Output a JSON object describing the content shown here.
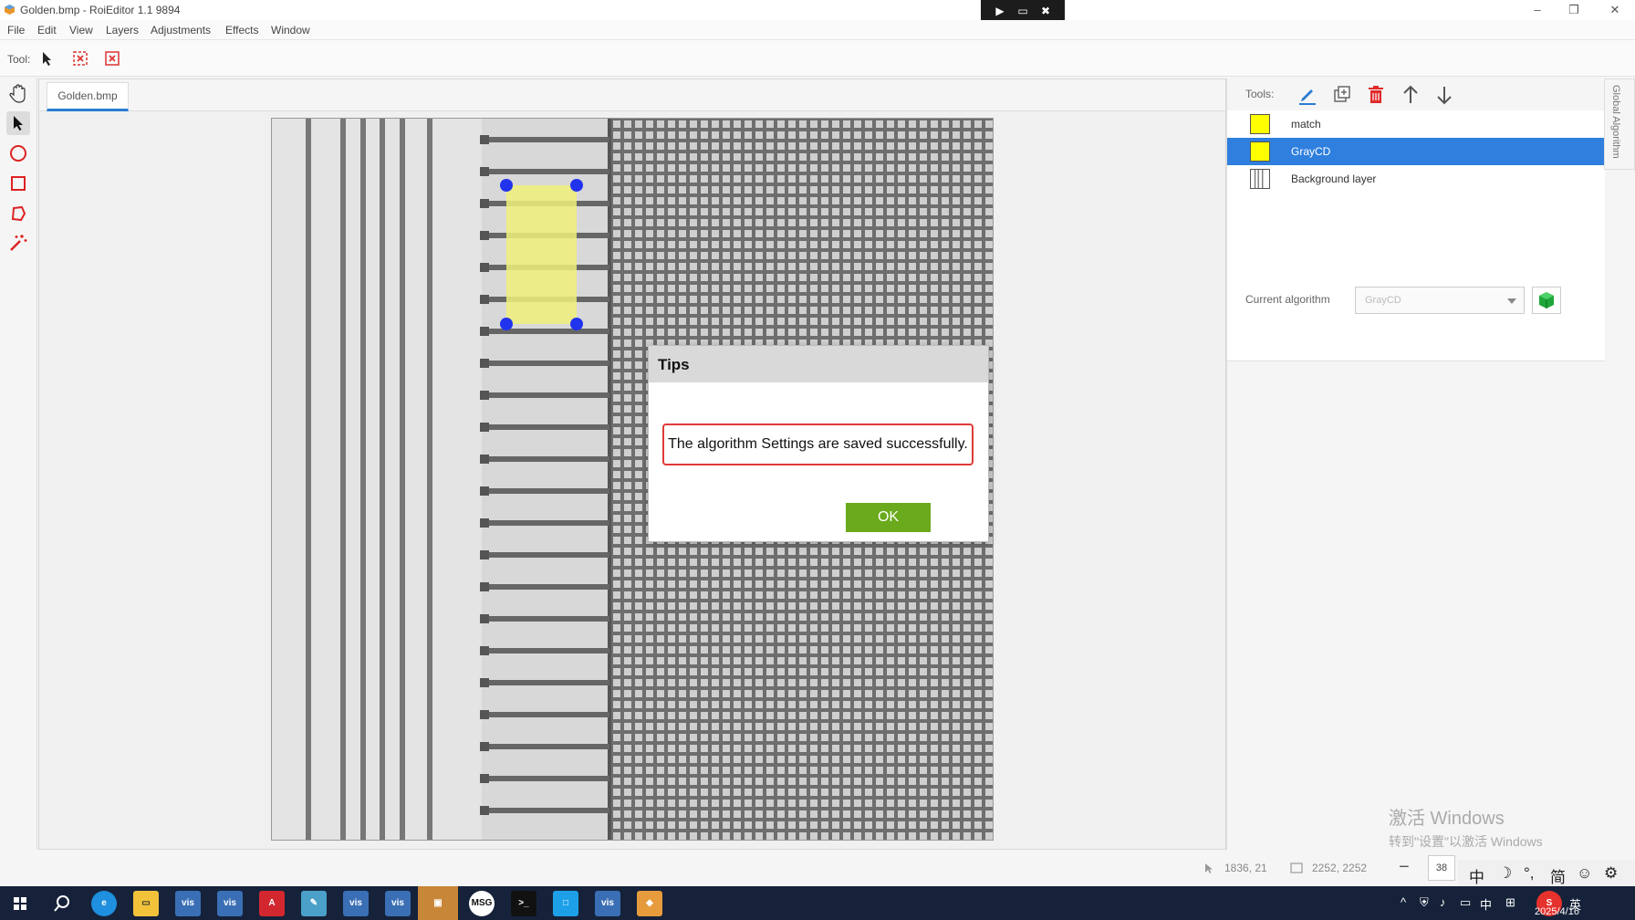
{
  "window": {
    "title": "Golden.bmp - RoiEditor 1.1 9894"
  },
  "menu": [
    "File",
    "Edit",
    "View",
    "Layers",
    "Adjustments",
    "Effects",
    "Window"
  ],
  "toolbar": {
    "tool_label": "Tool:"
  },
  "document": {
    "tab": "Golden.bmp"
  },
  "right_panel": {
    "tools_label": "Tools:",
    "side_tab": "Global Algorithm",
    "layers": [
      {
        "name": "match",
        "color": "#ffff00",
        "selected": false
      },
      {
        "name": "GrayCD",
        "color": "#ffff00",
        "selected": true
      },
      {
        "name": "Background layer",
        "color": "#ffffff",
        "selected": false
      }
    ],
    "current_algorithm_label": "Current algorithm",
    "current_algorithm_value": "GrayCD"
  },
  "dialog": {
    "title": "Tips",
    "message": "The algorithm Settings are saved successfully.",
    "ok_label": "OK"
  },
  "status": {
    "cursor_pos": "1836, 21",
    "image_size": "2252, 2252",
    "zoom": "38"
  },
  "watermark": {
    "line1": "激活 Windows",
    "line2": "转到\"设置\"以激活 Windows"
  },
  "ime": {
    "mode": "中",
    "simplified": "简"
  },
  "taskbar": {
    "apps": [
      "windows",
      "search",
      "edge",
      "explorer",
      "vis",
      "vis",
      "app",
      "app",
      "vis",
      "vis",
      "app",
      "msg",
      "terminal",
      "app",
      "vis",
      "app"
    ],
    "tray_lang": "中",
    "tray_input": "英",
    "date": "2025/4/16"
  },
  "colors": {
    "accent": "#2f7fde",
    "ok_button": "#6aaa1c",
    "roi_fill": "#f0f07a",
    "roi_handle": "#2233ee"
  }
}
